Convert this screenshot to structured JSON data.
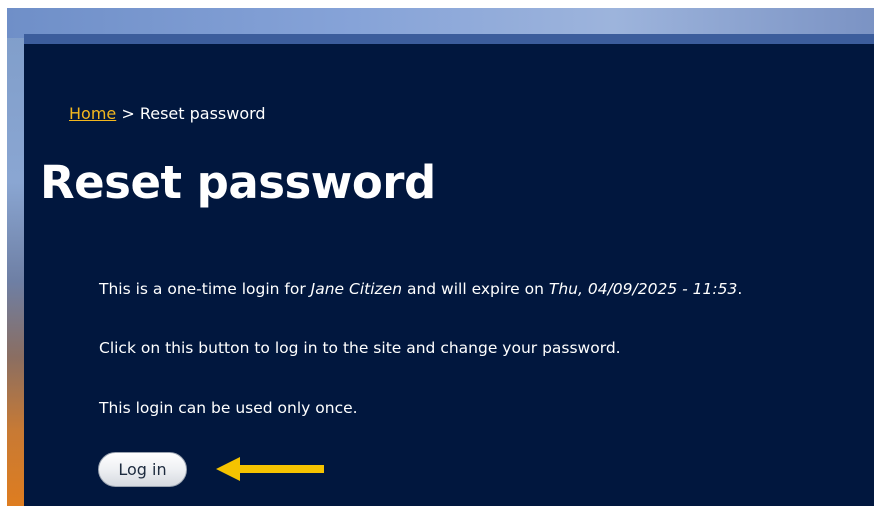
{
  "breadcrumb": {
    "home": "Home",
    "separator": " > ",
    "current": "Reset password"
  },
  "page": {
    "title": "Reset password",
    "line1": {
      "prefix": "This is a one-time login for ",
      "name": "Jane Citizen",
      "middle": " and will expire on ",
      "expiry": "Thu, 04/09/2025 - 11:53",
      "suffix": "."
    },
    "line2": "Click on this button to log in to the site and change your password.",
    "line3": "This login can be used only once.",
    "login_label": "Log in"
  },
  "colors": {
    "panel": "#01173e",
    "link": "#f3b71e",
    "arrow": "#f5c300"
  },
  "icons": {
    "annotation": "arrow-left-icon"
  }
}
